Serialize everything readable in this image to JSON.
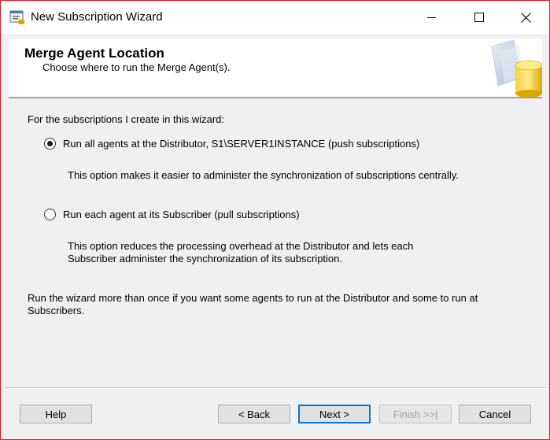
{
  "window": {
    "title": "New Subscription Wizard",
    "icon": "wizard-app-icon",
    "accent_border": "#e81123"
  },
  "header": {
    "title": "Merge Agent Location",
    "subtitle": "Choose where to run the Merge Agent(s)."
  },
  "body": {
    "intro": "For the subscriptions I create in this wizard:",
    "options": [
      {
        "label": "Run all agents at the Distributor, S1\\SERVER1INSTANCE (push subscriptions)",
        "description": "This option makes it easier to administer the synchronization of subscriptions centrally.",
        "selected": true
      },
      {
        "label": "Run each agent at its Subscriber (pull subscriptions)",
        "description_line1": "This option reduces the processing overhead at the Distributor and lets each",
        "description_line2": "Subscriber administer the synchronization of its subscription.",
        "selected": false
      }
    ],
    "note_line1": "Run the wizard more than once if you want some agents to run at the Distributor and some to run at",
    "note_line2": "Subscribers."
  },
  "buttons": {
    "help": "Help",
    "back": "< Back",
    "next": "Next >",
    "finish": "Finish >>|",
    "cancel": "Cancel"
  },
  "colors": {
    "focus_button_border": "#0078d7",
    "disabled_text": "#a0a0a0"
  }
}
